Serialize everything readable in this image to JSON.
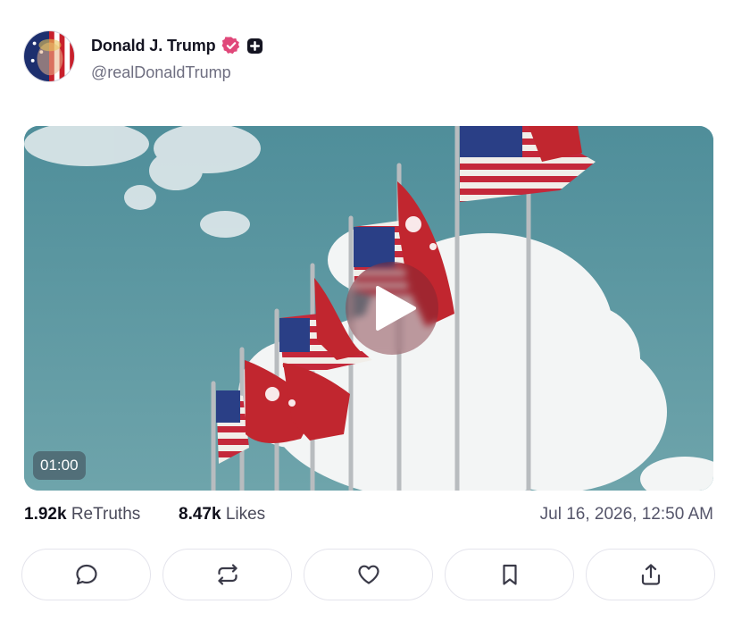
{
  "post": {
    "author": {
      "display_name": "Donald J. Trump",
      "handle": "@realDonaldTrump"
    },
    "media": {
      "type": "video",
      "duration": "01:00"
    },
    "stats": {
      "retruths_count": "1.92k",
      "retruths_label": "ReTruths",
      "likes_count": "8.47k",
      "likes_label": "Likes"
    },
    "timestamp": "Jul 16, 2026, 12:50 AM"
  },
  "actions": [
    "reply-icon",
    "retruth-icon",
    "heart-icon",
    "bookmark-icon",
    "share-icon"
  ],
  "colors": {
    "verified_badge": "#e0487a",
    "text_primary": "#0f0f1a",
    "text_muted": "#6e6e80",
    "sky": "#5f9aa4"
  }
}
